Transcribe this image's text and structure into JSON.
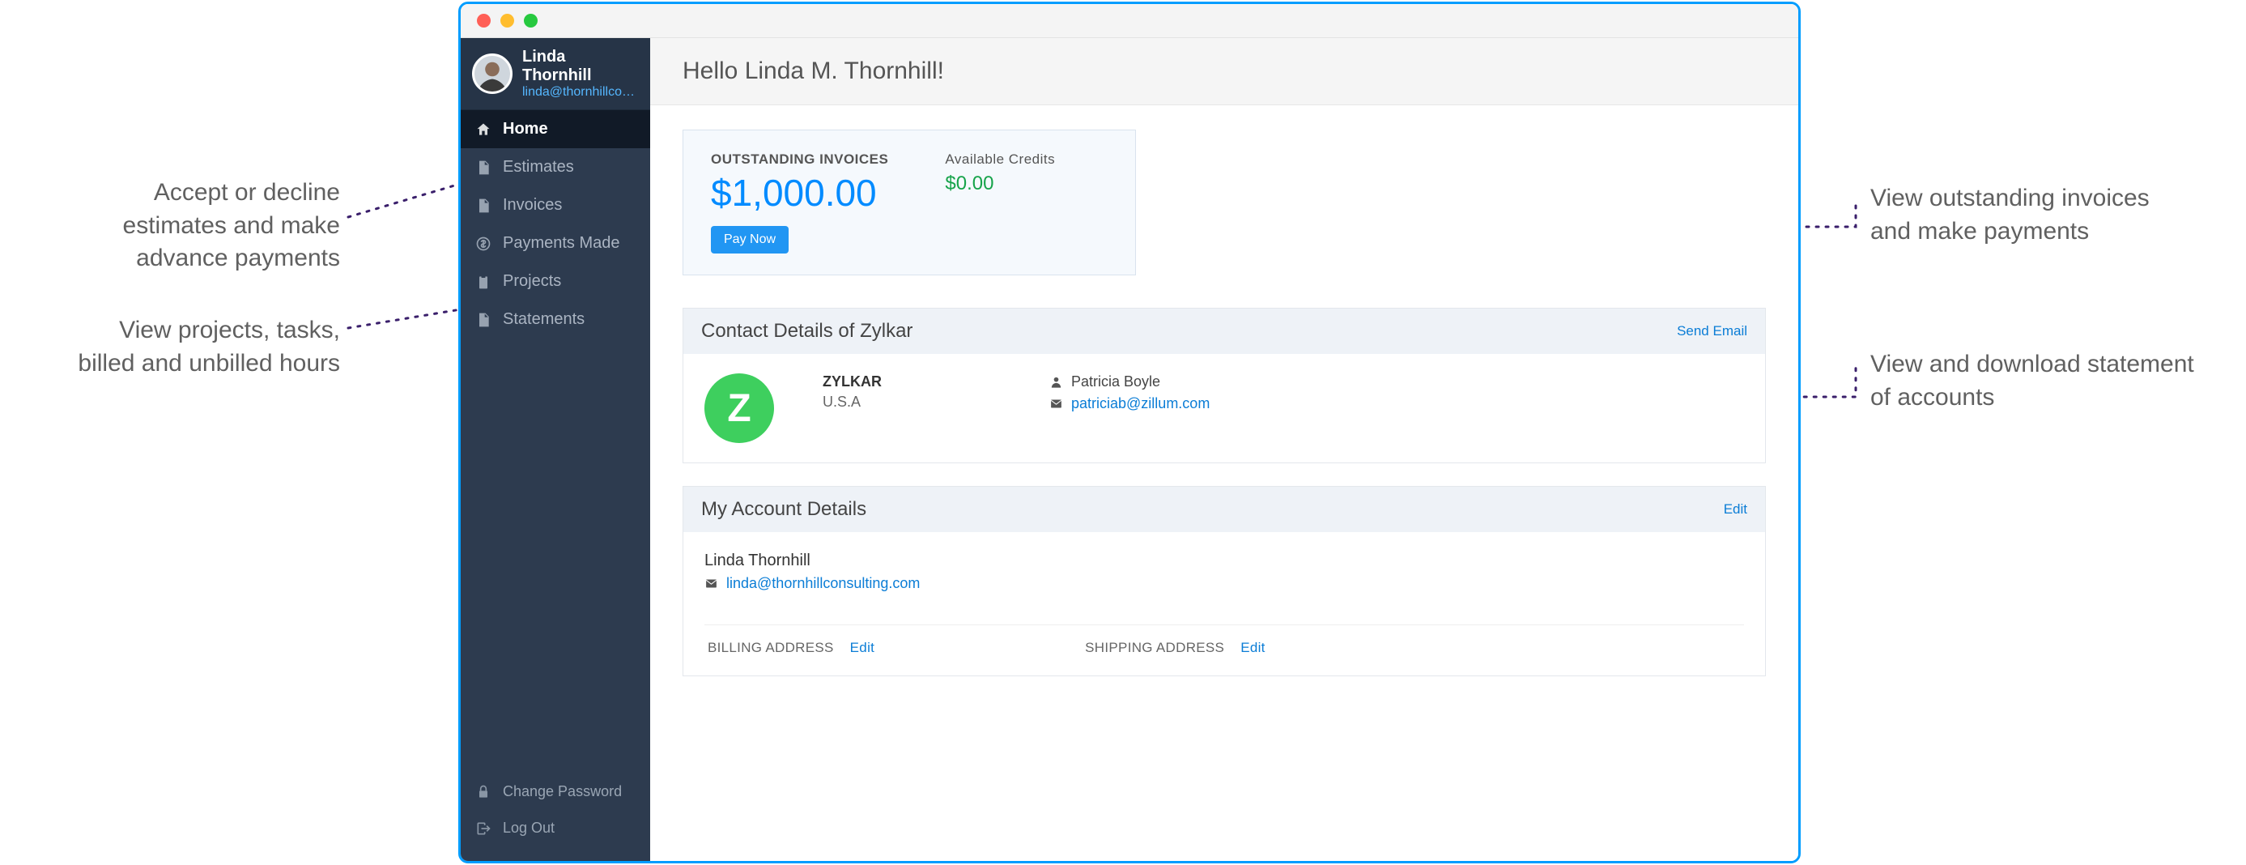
{
  "callouts": {
    "estimates": "Accept or decline\nestimates and make\nadvance payments",
    "projects": "View projects, tasks,\nbilled and unbilled hours",
    "outstanding": "View outstanding invoices\nand make payments",
    "statements": "View and download statement\nof accounts"
  },
  "profile": {
    "name": "Linda Thornhill",
    "email": "linda@thornhillcon..."
  },
  "sidebar": {
    "items": [
      {
        "label": "Home",
        "icon": "home"
      },
      {
        "label": "Estimates",
        "icon": "file"
      },
      {
        "label": "Invoices",
        "icon": "file"
      },
      {
        "label": "Payments Made",
        "icon": "coin"
      },
      {
        "label": "Projects",
        "icon": "clipboard"
      },
      {
        "label": "Statements",
        "icon": "file"
      }
    ],
    "bottom": [
      {
        "label": "Change Password",
        "icon": "lock"
      },
      {
        "label": "Log Out",
        "icon": "logout"
      }
    ]
  },
  "hero": {
    "greeting": "Hello Linda M. Thornhill!"
  },
  "summary": {
    "outstanding_label": "OUTSTANDING INVOICES",
    "outstanding_value": "$1,000.00",
    "credits_label": "Available Credits",
    "credits_value": "$0.00",
    "paynow": "Pay Now"
  },
  "contact": {
    "panel_title": "Contact Details of Zylkar",
    "send_email": "Send Email",
    "org_initial": "Z",
    "org_name": "ZYLKAR",
    "org_country": "U.S.A",
    "person_name": "Patricia Boyle",
    "person_email": "patriciab@zillum.com"
  },
  "account": {
    "panel_title": "My Account Details",
    "edit": "Edit",
    "name": "Linda Thornhill",
    "email": "linda@thornhillconsulting.com"
  },
  "addresses": {
    "billing_label": "BILLING ADDRESS",
    "shipping_label": "SHIPPING ADDRESS",
    "edit": "Edit"
  }
}
